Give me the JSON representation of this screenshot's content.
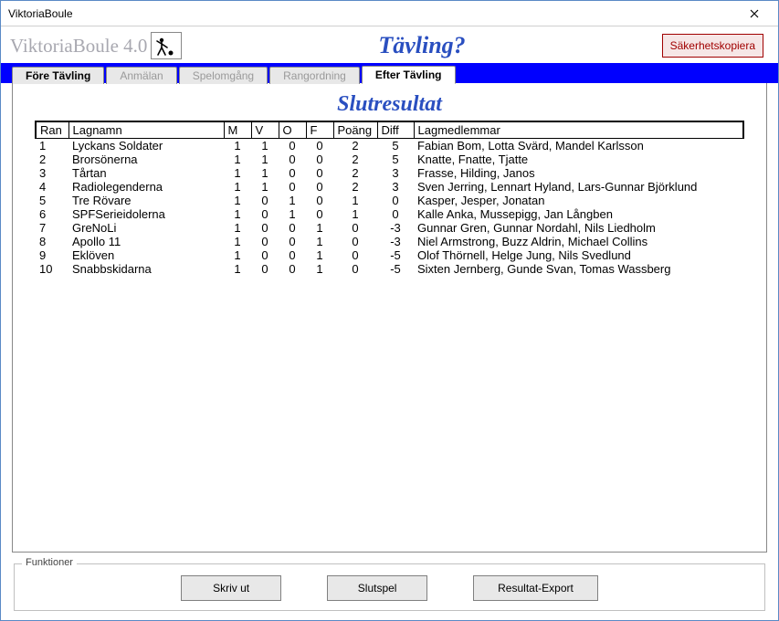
{
  "window": {
    "title": "ViktoriaBoule"
  },
  "header": {
    "app_title": "ViktoriaBoule 4.0",
    "center_title": "Tävling?",
    "backup_label": "Säkerhetskopiera"
  },
  "tabs": [
    {
      "label": "Före Tävling"
    },
    {
      "label": "Anmälan"
    },
    {
      "label": "Spelomgång"
    },
    {
      "label": "Rangordning"
    },
    {
      "label": "Efter Tävling"
    }
  ],
  "results": {
    "title": "Slutresultat",
    "columns": {
      "ran": "Ran",
      "lagnamn": "Lagnamn",
      "m": "M",
      "v": "V",
      "o": "O",
      "f": "F",
      "poang": "Poäng",
      "diff": "Diff",
      "lagmedlemmar": "Lagmedlemmar"
    },
    "rows": [
      {
        "ran": "1",
        "lagnamn": "Lyckans Soldater",
        "m": "1",
        "v": "1",
        "o": "0",
        "f": "0",
        "poang": "2",
        "diff": "5",
        "lagmedlemmar": "Fabian Bom, Lotta Svärd, Mandel Karlsson"
      },
      {
        "ran": "2",
        "lagnamn": "Brorsönerna",
        "m": "1",
        "v": "1",
        "o": "0",
        "f": "0",
        "poang": "2",
        "diff": "5",
        "lagmedlemmar": "Knatte, Fnatte, Tjatte"
      },
      {
        "ran": "3",
        "lagnamn": "Tårtan",
        "m": "1",
        "v": "1",
        "o": "0",
        "f": "0",
        "poang": "2",
        "diff": "3",
        "lagmedlemmar": "Frasse, Hilding, Janos"
      },
      {
        "ran": "4",
        "lagnamn": "Radiolegenderna",
        "m": "1",
        "v": "1",
        "o": "0",
        "f": "0",
        "poang": "2",
        "diff": "3",
        "lagmedlemmar": "Sven Jerring, Lennart Hyland, Lars-Gunnar Björklund"
      },
      {
        "ran": "5",
        "lagnamn": "Tre Rövare",
        "m": "1",
        "v": "0",
        "o": "1",
        "f": "0",
        "poang": "1",
        "diff": "0",
        "lagmedlemmar": "Kasper, Jesper, Jonatan"
      },
      {
        "ran": "6",
        "lagnamn": "SPFSerieidolerna",
        "m": "1",
        "v": "0",
        "o": "1",
        "f": "0",
        "poang": "1",
        "diff": "0",
        "lagmedlemmar": "Kalle Anka, Mussepigg, Jan Långben"
      },
      {
        "ran": "7",
        "lagnamn": "GreNoLi",
        "m": "1",
        "v": "0",
        "o": "0",
        "f": "1",
        "poang": "0",
        "diff": "-3",
        "lagmedlemmar": "Gunnar Gren, Gunnar Nordahl, Nils Liedholm"
      },
      {
        "ran": "8",
        "lagnamn": "Apollo 11",
        "m": "1",
        "v": "0",
        "o": "0",
        "f": "1",
        "poang": "0",
        "diff": "-3",
        "lagmedlemmar": "Niel Armstrong, Buzz Aldrin, Michael Collins"
      },
      {
        "ran": "9",
        "lagnamn": "Eklöven",
        "m": "1",
        "v": "0",
        "o": "0",
        "f": "1",
        "poang": "0",
        "diff": "-5",
        "lagmedlemmar": "Olof Thörnell, Helge Jung, Nils Svedlund"
      },
      {
        "ran": "10",
        "lagnamn": "Snabbskidarna",
        "m": "1",
        "v": "0",
        "o": "0",
        "f": "1",
        "poang": "0",
        "diff": "-5",
        "lagmedlemmar": "Sixten Jernberg, Gunde Svan, Tomas Wassberg"
      }
    ]
  },
  "functions": {
    "group_label": "Funktioner",
    "print_label": "Skriv ut",
    "playoff_label": "Slutspel",
    "export_label": "Resultat-Export"
  }
}
